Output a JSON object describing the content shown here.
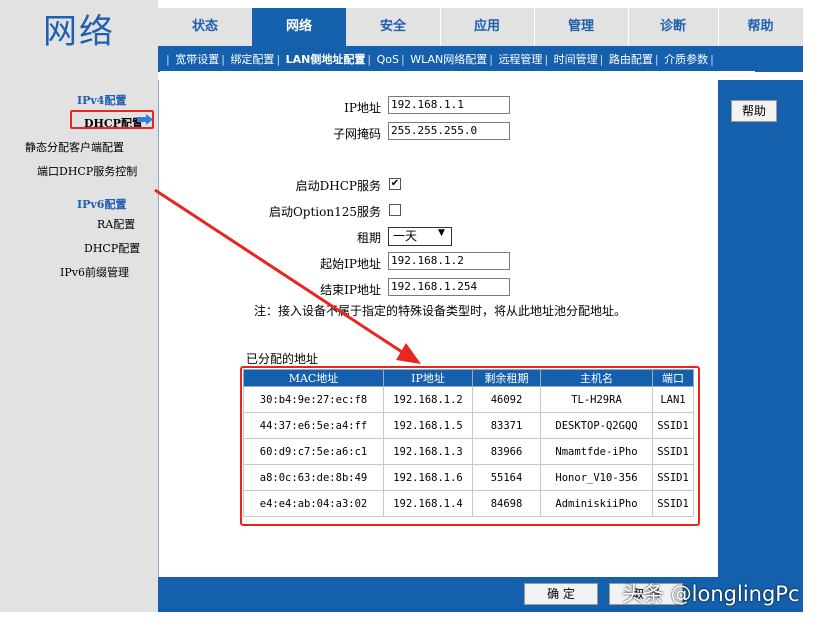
{
  "logo": "网络",
  "top_tabs": [
    {
      "label": "状态",
      "active": false
    },
    {
      "label": "网络",
      "active": true
    },
    {
      "label": "安全",
      "active": false
    },
    {
      "label": "应用",
      "active": false
    },
    {
      "label": "管理",
      "active": false
    },
    {
      "label": "诊断",
      "active": false
    },
    {
      "label": "帮助",
      "active": false
    }
  ],
  "sub_nav": [
    "宽带设置",
    "绑定配置",
    "LAN侧地址配置",
    "QoS",
    "WLAN网络配置",
    "远程管理",
    "时间管理",
    "路由配置",
    "介质参数"
  ],
  "sub_nav_active_index": 2,
  "sidebar": {
    "ipv4_header": "IPv4配置",
    "ipv4_items": [
      "DHCP配置",
      "静态分配客户端配置",
      "端口DHCP服务控制"
    ],
    "ipv6_header": "IPv6配置",
    "ipv6_items": [
      "RA配置",
      "DHCP配置",
      "IPv6前缀管理"
    ]
  },
  "help_button": "帮助",
  "form": {
    "ip_label": "IP地址",
    "ip_value": "192.168.1.1",
    "mask_label": "子网掩码",
    "mask_value": "255.255.255.0",
    "dhcp_label": "启动DHCP服务",
    "dhcp_checked": true,
    "opt125_label": "启动Option125服务",
    "opt125_checked": false,
    "lease_label": "租期",
    "lease_value": "一天",
    "start_label": "起始IP地址",
    "start_value": "192.168.1.2",
    "end_label": "结束IP地址",
    "end_value": "192.168.1.254"
  },
  "note": "注：接入设备不属于指定的特殊设备类型时，将从此地址池分配地址。",
  "assigned": {
    "title": "已分配的地址",
    "headers": [
      "MAC地址",
      "IP地址",
      "剩余租期",
      "主机名",
      "端口"
    ],
    "rows": [
      [
        "30:b4:9e:27:ec:f8",
        "192.168.1.2",
        "46092",
        "TL-H29RA",
        "LAN1"
      ],
      [
        "44:37:e6:5e:a4:ff",
        "192.168.1.5",
        "83371",
        "DESKTOP-Q2GQQ",
        "SSID1"
      ],
      [
        "60:d9:c7:5e:a6:c1",
        "192.168.1.3",
        "83966",
        "Nmamtfde-iPho",
        "SSID1"
      ],
      [
        "a8:0c:63:de:8b:49",
        "192.168.1.6",
        "55164",
        "Honor_V10-356",
        "SSID1"
      ],
      [
        "e4:e4:ab:04:a3:02",
        "192.168.1.4",
        "84698",
        "AdminiskiiPho",
        "SSID1"
      ]
    ]
  },
  "ok_button": "确 定",
  "cancel_button": "取 消",
  "watermark": "头条 @longlingPc",
  "colors": {
    "nav_blue": "#1460ad",
    "logo_blue": "#1f5fb0",
    "annotation_red": "#e8261d",
    "panel_gray": "#e2e2e2"
  }
}
